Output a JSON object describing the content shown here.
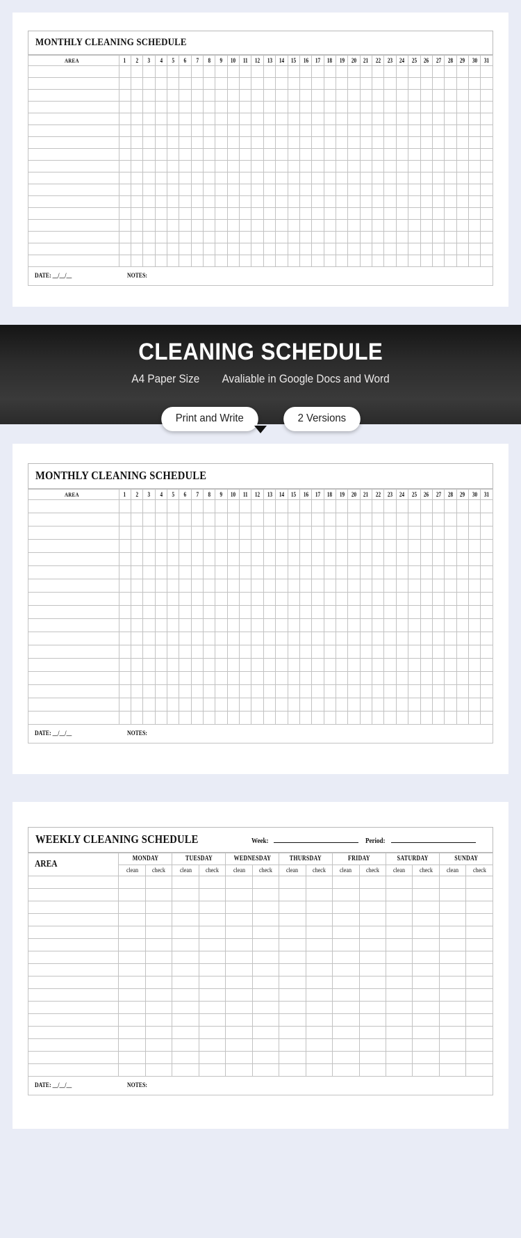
{
  "banner": {
    "title": "CLEANING SCHEDULE",
    "subtitle_left": "A4 Paper Size",
    "subtitle_right": "Avaliable in Google Docs and Word",
    "pill_one": "Print and Write",
    "pill_two": "2 Versions",
    "caret_icon": "triangle-down-icon",
    "bg_color": "#2c2c2c",
    "text_color": "#ffffff"
  },
  "page": {
    "background_color": "#e9ecf6",
    "sheet_color": "#ffffff"
  },
  "monthly": {
    "title": "MONTHLY CLEANING SCHEDULE",
    "area_header": "AREA",
    "day_numbers": [
      "1",
      "2",
      "3",
      "4",
      "5",
      "6",
      "7",
      "8",
      "9",
      "10",
      "11",
      "12",
      "13",
      "14",
      "15",
      "16",
      "17",
      "18",
      "19",
      "20",
      "21",
      "22",
      "23",
      "24",
      "25",
      "26",
      "27",
      "28",
      "29",
      "30",
      "31"
    ],
    "row_count": 17,
    "footer_date_label": "DATE:  __/__/__",
    "footer_notes_label": "NOTES:"
  },
  "weekly": {
    "title": "WEEKLY CLEANING SCHEDULE",
    "week_label": "Week:",
    "period_label": "Period:",
    "area_header": "AREA",
    "days": [
      "MONDAY",
      "TUESDAY",
      "WEDNESDAY",
      "THURSDAY",
      "FRIDAY",
      "SATURDAY",
      "SUNDAY"
    ],
    "sub_columns": [
      "clean",
      "check"
    ],
    "row_count": 16,
    "footer_date_label": "DATE:  __/__/__",
    "footer_notes_label": "NOTES:"
  }
}
